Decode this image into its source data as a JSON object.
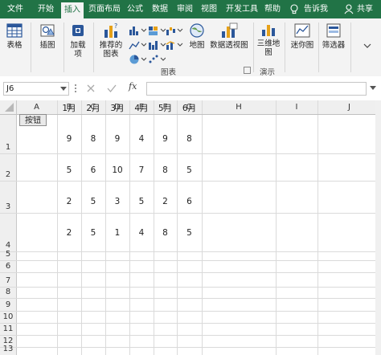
{
  "menubar": {
    "tabs": [
      {
        "label": "文件",
        "active": false
      },
      {
        "label": "开始",
        "active": false
      },
      {
        "label": "插入",
        "active": true
      },
      {
        "label": "页面布局",
        "active": false
      },
      {
        "label": "公式",
        "active": false
      },
      {
        "label": "数据",
        "active": false
      },
      {
        "label": "审阅",
        "active": false
      },
      {
        "label": "视图",
        "active": false
      },
      {
        "label": "开发工具",
        "active": false
      },
      {
        "label": "帮助",
        "active": false
      }
    ],
    "tell_me": "告诉我",
    "share": "共享",
    "bg_color": "#217346"
  },
  "ribbon": {
    "table_label": "表格",
    "illustration_label": "插图",
    "addin_label_1": "加载",
    "addin_label_2": "项",
    "recommended_chart_label_1": "推荐的",
    "recommended_chart_label_2": "图表",
    "map_label": "地图",
    "pivot_chart_label": "数据透视图",
    "charts_group_label": "图表",
    "map3d_label_1": "三维地",
    "map3d_label_2": "图",
    "tours_group_label": "演示",
    "sparkline_label": "迷你图",
    "filter_label": "筛选器"
  },
  "formula_bar": {
    "name_box": "J6",
    "fx": "fx",
    "formula": ""
  },
  "sheet": {
    "columns": [
      "A",
      "B",
      "C",
      "D",
      "E",
      "F",
      "G",
      "H",
      "I",
      "J"
    ],
    "rows": [
      "1",
      "2",
      "3",
      "4",
      "5",
      "6",
      "7",
      "8",
      "9",
      "10",
      "11",
      "12",
      "13"
    ],
    "button_label": "按钮",
    "headers": [
      "1月",
      "2月",
      "3月",
      "4月",
      "5月",
      "6月"
    ],
    "values": [
      [
        "9",
        "8",
        "9",
        "4",
        "9",
        "8"
      ],
      [
        "5",
        "6",
        "10",
        "7",
        "8",
        "5"
      ],
      [
        "2",
        "5",
        "3",
        "5",
        "2",
        "6"
      ],
      [
        "2",
        "5",
        "1",
        "4",
        "8",
        "5"
      ]
    ]
  }
}
